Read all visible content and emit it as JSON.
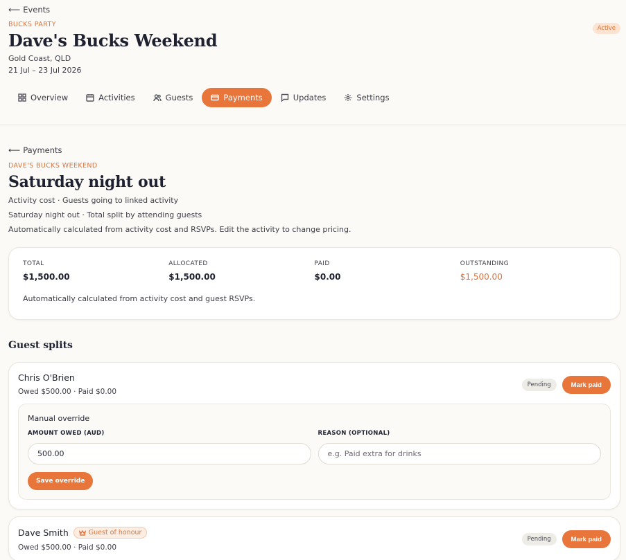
{
  "header": {
    "back_label": "Events",
    "category": "BUCKS PARTY",
    "title": "Dave's Bucks Weekend",
    "location": "Gold Coast, QLD",
    "dates": "21 Jul – 23 Jul 2026",
    "status": "Active"
  },
  "tabs": [
    {
      "label": "Overview",
      "icon": "grid-icon"
    },
    {
      "label": "Activities",
      "icon": "calendar-icon"
    },
    {
      "label": "Guests",
      "icon": "users-icon"
    },
    {
      "label": "Payments",
      "icon": "card-icon",
      "active": true
    },
    {
      "label": "Updates",
      "icon": "message-icon"
    },
    {
      "label": "Settings",
      "icon": "gear-icon"
    }
  ],
  "page": {
    "back_label": "Payments",
    "eyebrow": "DAVE'S BUCKS WEEKEND",
    "title": "Saturday night out",
    "line1": "Activity cost · Guests going to linked activity",
    "line2": "Saturday night out · Total split by attending guests",
    "line3": "Automatically calculated from activity cost and RSVPs. Edit the activity to change pricing."
  },
  "summary": {
    "total_label": "TOTAL",
    "total_value": "$1,500.00",
    "allocated_label": "ALLOCATED",
    "allocated_value": "$1,500.00",
    "paid_label": "PAID",
    "paid_value": "$0.00",
    "outstanding_label": "OUTSTANDING",
    "outstanding_value": "$1,500.00",
    "note": "Automatically calculated from activity cost and guest RSVPs."
  },
  "guest_splits": {
    "title": "Guest splits",
    "guests": [
      {
        "name": "Chris O'Brien",
        "summary": "Owed $500.00 · Paid $0.00",
        "status": "Pending",
        "action": "Mark paid",
        "override": {
          "title": "Manual override",
          "amount_label": "AMOUNT OWED (AUD)",
          "amount_value": "500.00",
          "reason_label": "REASON (OPTIONAL)",
          "reason_placeholder": "e.g. Paid extra for drinks",
          "save_label": "Save override"
        }
      },
      {
        "name": "Dave Smith",
        "badge": "Guest of honour",
        "summary": "Owed $500.00 · Paid $0.00",
        "status": "Pending",
        "action": "Mark paid"
      }
    ]
  },
  "colors": {
    "accent": "#e8753a",
    "background": "#fcfaf6"
  }
}
